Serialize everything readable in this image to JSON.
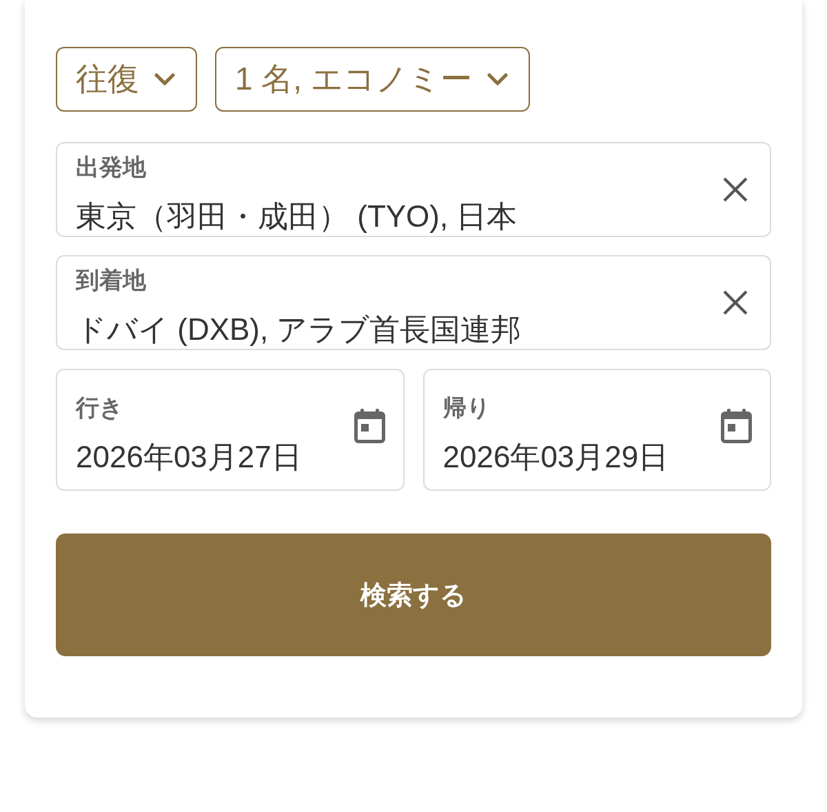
{
  "dropdowns": [
    {
      "label": "往復"
    },
    {
      "label": "1 名, エコノミー"
    }
  ],
  "locations": [
    {
      "label": "出発地",
      "value": "東京（羽田・成田） (TYO), 日本"
    },
    {
      "label": "到着地",
      "value": "ドバイ (DXB), アラブ首長国連邦"
    }
  ],
  "dates": [
    {
      "label": "行き",
      "value": "2026年03月27日"
    },
    {
      "label": "帰り",
      "value": "2026年03月29日"
    }
  ],
  "search_button": {
    "label": "検索する"
  }
}
